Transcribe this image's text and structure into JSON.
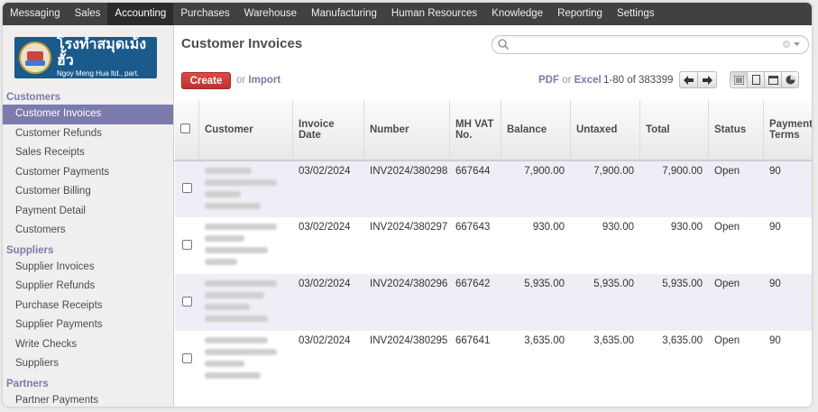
{
  "topbar": {
    "items": [
      {
        "label": "Messaging",
        "active": false
      },
      {
        "label": "Sales",
        "active": false
      },
      {
        "label": "Accounting",
        "active": true
      },
      {
        "label": "Purchases",
        "active": false
      },
      {
        "label": "Warehouse",
        "active": false
      },
      {
        "label": "Manufacturing",
        "active": false
      },
      {
        "label": "Human Resources",
        "active": false
      },
      {
        "label": "Knowledge",
        "active": false
      },
      {
        "label": "Reporting",
        "active": false
      },
      {
        "label": "Settings",
        "active": false
      }
    ]
  },
  "logo": {
    "line1": "โรงทำสมุดเม้งฮั้ว",
    "line2": "Ngoy Meng Hua ltd., part."
  },
  "sidebar": {
    "sections": [
      {
        "title": "Customers",
        "items": [
          "Customer Invoices",
          "Customer Refunds",
          "Sales Receipts",
          "Customer Payments",
          "Customer Billing",
          "Payment Detail",
          "Customers"
        ]
      },
      {
        "title": "Suppliers",
        "items": [
          "Supplier Invoices",
          "Supplier Refunds",
          "Purchase Receipts",
          "Supplier Payments",
          "Write Checks",
          "Suppliers"
        ]
      },
      {
        "title": "Partners",
        "items": [
          "Partner Payments"
        ]
      }
    ],
    "active_item": "Customer Invoices"
  },
  "main": {
    "title": "Customer Invoices",
    "search": {
      "value": "",
      "placeholder": ""
    },
    "create_label": "Create",
    "or_text": "or",
    "import_label": "Import",
    "export": {
      "pdf": "PDF",
      "or": "or",
      "excel": "Excel"
    },
    "pager": "1-80 of 383399"
  },
  "table": {
    "columns": [
      "Customer",
      "Invoice Date",
      "Number",
      "MH VAT No.",
      "Balance",
      "Untaxed",
      "Total",
      "Status",
      "Payment Terms"
    ],
    "rows": [
      {
        "invoice_date": "03/02/2024",
        "number": "INV2024/380298",
        "vat": "667644",
        "balance": "7,900.00",
        "untaxed": "7,900.00",
        "total": "7,900.00",
        "status": "Open",
        "terms": "90"
      },
      {
        "invoice_date": "03/02/2024",
        "number": "INV2024/380297",
        "vat": "667643",
        "balance": "930.00",
        "untaxed": "930.00",
        "total": "930.00",
        "status": "Open",
        "terms": "90"
      },
      {
        "invoice_date": "03/02/2024",
        "number": "INV2024/380296",
        "vat": "667642",
        "balance": "5,935.00",
        "untaxed": "5,935.00",
        "total": "5,935.00",
        "status": "Open",
        "terms": "90"
      },
      {
        "invoice_date": "03/02/2024",
        "number": "INV2024/380295",
        "vat": "667641",
        "balance": "3,635.00",
        "untaxed": "3,635.00",
        "total": "3,635.00",
        "status": "Open",
        "terms": "90"
      }
    ]
  },
  "colors": {
    "topbar": "#414141",
    "accent": "#7c7bad",
    "create": "#d23f3f",
    "row_alt": "#eeeef6"
  }
}
